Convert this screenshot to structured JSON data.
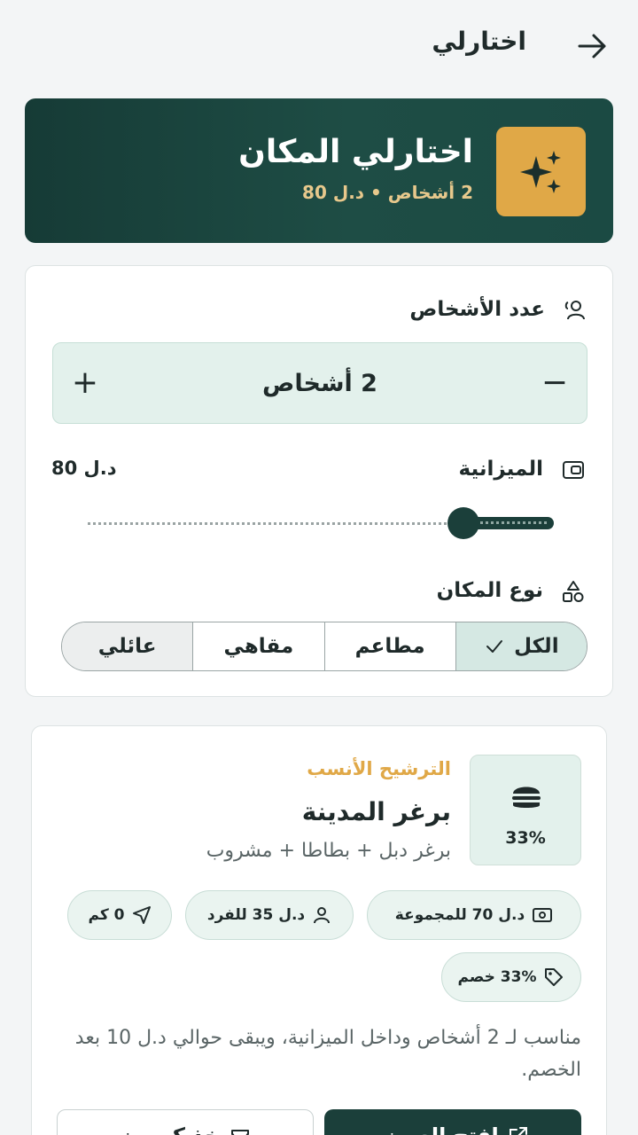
{
  "header": {
    "title": "اختارلي",
    "back_icon": "arrow-right-icon"
  },
  "hero": {
    "title": "اختارلي المكان",
    "subtitle": "2 أشخاص • د.ل 80",
    "icon": "sparkles-icon",
    "accent_color": "#e0a847",
    "bg_color": "#1b4a43"
  },
  "filters": {
    "people": {
      "label": "عدد الأشخاص",
      "icon": "users-icon",
      "value": "2 أشخاص",
      "minus": "−",
      "plus": "+"
    },
    "budget": {
      "label": "الميزانية",
      "icon": "wallet-icon",
      "value": "د.ل 80",
      "slider_fraction": 0.18
    },
    "place_type": {
      "label": "نوع المكان",
      "icon": "shapes-icon",
      "options": [
        "الكل",
        "مطاعم",
        "مقاهي",
        "عائلي"
      ],
      "selected": "الكل"
    }
  },
  "result": {
    "tag": "الترشيح الأنسب",
    "name": "برغر المدينة",
    "description": "برغر دبل + بطاطا + مشروب",
    "icon": "burger-icon",
    "match": "33%",
    "chips": {
      "group_price": "د.ل 70 للمجموعة",
      "person_price": "د.ل 35 للفرد",
      "distance": "0 كم",
      "discount": "33% خصم"
    },
    "note": "مناسب لـ 2 أشخاص وداخل الميزانية، ويبقى حوالي د.ل 10 بعد الخصم.",
    "primary_button": "افتح العرض",
    "secondary_button": "خذ كوبون"
  }
}
